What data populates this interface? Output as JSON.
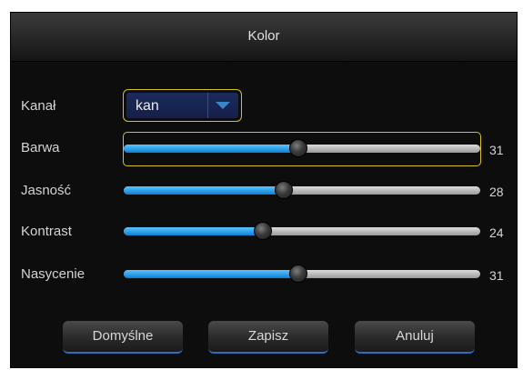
{
  "dialog": {
    "title": "Kolor"
  },
  "channel": {
    "label": "Kanał",
    "value": "kan"
  },
  "sliders": [
    {
      "label": "Barwa",
      "value": "31",
      "fraction": 0.49
    },
    {
      "label": "Jasność",
      "value": "28",
      "fraction": 0.45
    },
    {
      "label": "Kontrast",
      "value": "24",
      "fraction": 0.39
    },
    {
      "label": "Nasycenie",
      "value": "31",
      "fraction": 0.49
    }
  ],
  "buttons": {
    "default": "Domyślne",
    "save": "Zapisz",
    "cancel": "Anuluj"
  },
  "colors": {
    "accent": "#d6c21f",
    "fill": "#1a8fe6",
    "background": "#0d0d0d"
  }
}
